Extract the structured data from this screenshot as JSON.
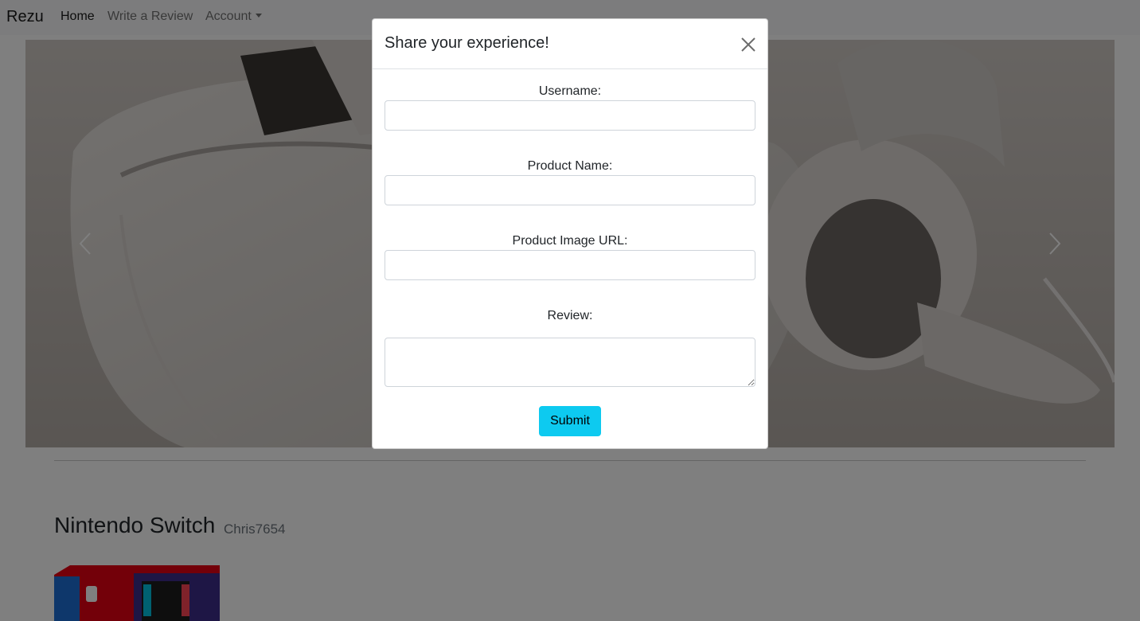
{
  "navbar": {
    "brand": "Rezu",
    "links": [
      {
        "label": "Home"
      },
      {
        "label": "Write a Review"
      },
      {
        "label": "Account"
      }
    ]
  },
  "latest_review": {
    "product_name": "Nintendo Switch",
    "username": "Chris7654"
  },
  "modal": {
    "title": "Share your experience!",
    "fields": {
      "username": {
        "label": "Username:",
        "value": ""
      },
      "product_name": {
        "label": "Product Name:",
        "value": ""
      },
      "product_image_url": {
        "label": "Product Image URL:",
        "value": ""
      },
      "review": {
        "label": "Review:",
        "value": ""
      }
    },
    "submit_label": "Submit"
  },
  "icons": {
    "close": "close-icon",
    "carousel_prev": "chevron-left-icon",
    "carousel_next": "chevron-right-icon",
    "account_caret": "caret-down-icon"
  },
  "colors": {
    "submit_button": "#0dcaf0",
    "navbar_bg": "#f8f9fa"
  }
}
